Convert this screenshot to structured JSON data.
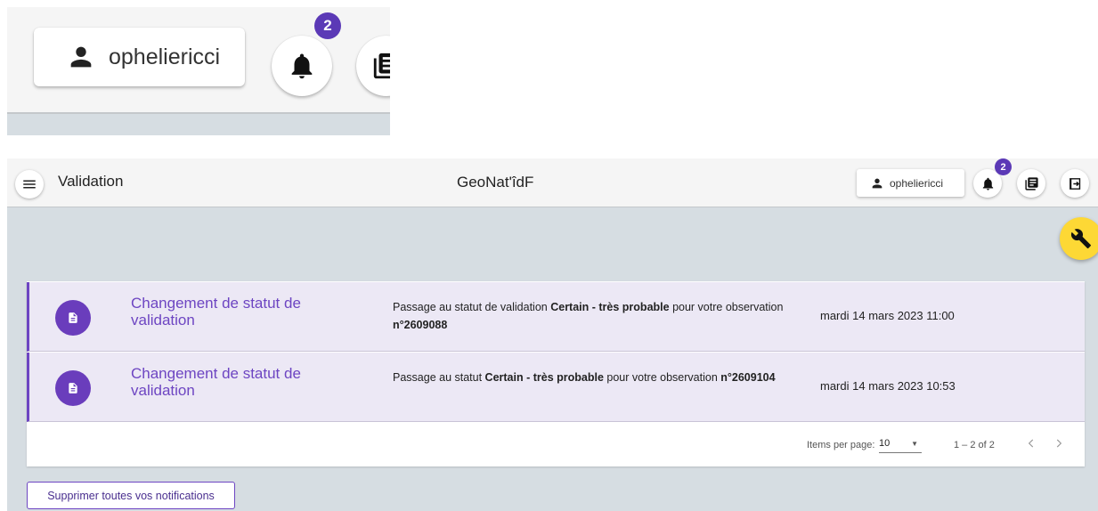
{
  "zoom": {
    "username": "opheliericci",
    "notification_count": "2"
  },
  "toolbar": {
    "menu_icon": "menu-icon",
    "app_title": "Validation",
    "site_title": "GeoNat'îdF",
    "username": "opheliericci",
    "notification_count": "2",
    "icons": [
      "account-icon",
      "bell-icon",
      "newspaper-icon",
      "logout-icon"
    ]
  },
  "fab": {
    "icon": "wrench-icon"
  },
  "notifications": [
    {
      "title": "Changement de statut de validation",
      "msg_pre": "Passage au statut de validation ",
      "msg_bold1": "Certain - très probable",
      "msg_mid": " pour votre observation ",
      "msg_bold2": "n°2609088",
      "date": "mardi 14 mars 2023 11:00",
      "icon": "document-icon"
    },
    {
      "title": "Changement de statut de validation",
      "msg_pre": "Passage au statut ",
      "msg_bold1": "Certain - très probable",
      "msg_mid": " pour votre observation ",
      "msg_bold2": "n°2609104",
      "date": "mardi 14 mars 2023 10:53",
      "icon": "document-icon"
    }
  ],
  "paginator": {
    "label": "Items per page:",
    "page_size": "10",
    "range": "1 – 2 of 2"
  },
  "actions": {
    "clear_all": "Supprimer toutes vos notifications"
  },
  "colors": {
    "accent": "#6d45c2",
    "badge": "#5b39b6",
    "fab": "#fdd835",
    "row_bg": "#ece8f5",
    "page_bg": "#d6dde2"
  }
}
